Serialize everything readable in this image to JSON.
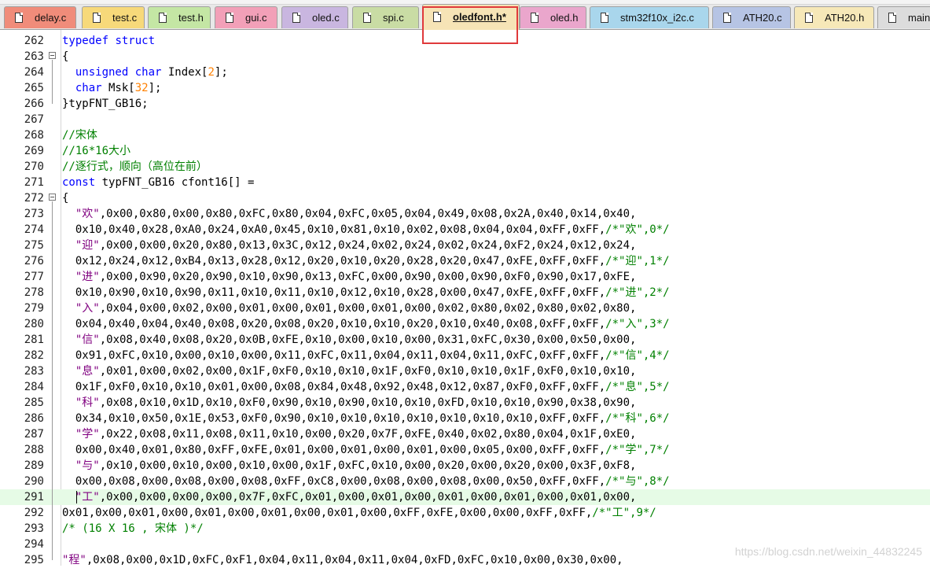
{
  "tabs": [
    {
      "label": "delay.c",
      "color": "#f08c7a",
      "active": false
    },
    {
      "label": "test.c",
      "color": "#f7d97a",
      "active": false
    },
    {
      "label": "test.h",
      "color": "#c4e6a4",
      "active": false
    },
    {
      "label": "gui.c",
      "color": "#f2a0b8",
      "active": false
    },
    {
      "label": "oled.c",
      "color": "#c9b6e0",
      "active": false
    },
    {
      "label": "spi.c",
      "color": "#c9dca4",
      "active": false
    },
    {
      "label": "oledfont.h*",
      "color": "#f6e4b6",
      "active": true
    },
    {
      "label": "oled.h",
      "color": "#eaa6cc",
      "active": false
    },
    {
      "label": "stm32f10x_i2c.c",
      "color": "#a9d6ec",
      "active": false
    },
    {
      "label": "ATH20.c",
      "color": "#b6c4e4",
      "active": false
    },
    {
      "label": "ATH20.h",
      "color": "#f6e8b8",
      "active": false
    },
    {
      "label": "main",
      "color": "#dcdcdc",
      "active": false
    }
  ],
  "editor": {
    "current_line": 291,
    "lines": [
      {
        "num": 262,
        "code": "typedef struct"
      },
      {
        "num": 263,
        "code": "{"
      },
      {
        "num": 264,
        "code": "  unsigned char Index[2];"
      },
      {
        "num": 265,
        "code": "  char Msk[32];"
      },
      {
        "num": 266,
        "code": "}typFNT_GB16;"
      },
      {
        "num": 267,
        "code": ""
      },
      {
        "num": 268,
        "code": "//宋体"
      },
      {
        "num": 269,
        "code": "//16*16大小"
      },
      {
        "num": 270,
        "code": "//逐行式，顺向（高位在前）"
      },
      {
        "num": 271,
        "code": "const typFNT_GB16 cfont16[] ="
      },
      {
        "num": 272,
        "code": "{"
      },
      {
        "num": 273,
        "code": "  \"欢\",0x00,0x80,0x00,0x80,0xFC,0x80,0x04,0xFC,0x05,0x04,0x49,0x08,0x2A,0x40,0x14,0x40,"
      },
      {
        "num": 274,
        "code": "  0x10,0x40,0x28,0xA0,0x24,0xA0,0x45,0x10,0x81,0x10,0x02,0x08,0x04,0x04,0xFF,0xFF,/*\"欢\",0*/"
      },
      {
        "num": 275,
        "code": "  \"迎\",0x00,0x00,0x20,0x80,0x13,0x3C,0x12,0x24,0x02,0x24,0x02,0x24,0xF2,0x24,0x12,0x24,"
      },
      {
        "num": 276,
        "code": "  0x12,0x24,0x12,0xB4,0x13,0x28,0x12,0x20,0x10,0x20,0x28,0x20,0x47,0xFE,0xFF,0xFF,/*\"迎\",1*/"
      },
      {
        "num": 277,
        "code": "  \"进\",0x00,0x90,0x20,0x90,0x10,0x90,0x13,0xFC,0x00,0x90,0x00,0x90,0xF0,0x90,0x17,0xFE,"
      },
      {
        "num": 278,
        "code": "  0x10,0x90,0x10,0x90,0x11,0x10,0x11,0x10,0x12,0x10,0x28,0x00,0x47,0xFE,0xFF,0xFF,/*\"进\",2*/"
      },
      {
        "num": 279,
        "code": "  \"入\",0x04,0x00,0x02,0x00,0x01,0x00,0x01,0x00,0x01,0x00,0x02,0x80,0x02,0x80,0x02,0x80,"
      },
      {
        "num": 280,
        "code": "  0x04,0x40,0x04,0x40,0x08,0x20,0x08,0x20,0x10,0x10,0x20,0x10,0x40,0x08,0xFF,0xFF,/*\"入\",3*/"
      },
      {
        "num": 281,
        "code": "  \"信\",0x08,0x40,0x08,0x20,0x0B,0xFE,0x10,0x00,0x10,0x00,0x31,0xFC,0x30,0x00,0x50,0x00,"
      },
      {
        "num": 282,
        "code": "  0x91,0xFC,0x10,0x00,0x10,0x00,0x11,0xFC,0x11,0x04,0x11,0x04,0x11,0xFC,0xFF,0xFF,/*\"信\",4*/"
      },
      {
        "num": 283,
        "code": "  \"息\",0x01,0x00,0x02,0x00,0x1F,0xF0,0x10,0x10,0x1F,0xF0,0x10,0x10,0x1F,0xF0,0x10,0x10,"
      },
      {
        "num": 284,
        "code": "  0x1F,0xF0,0x10,0x10,0x01,0x00,0x08,0x84,0x48,0x92,0x48,0x12,0x87,0xF0,0xFF,0xFF,/*\"息\",5*/"
      },
      {
        "num": 285,
        "code": "  \"科\",0x08,0x10,0x1D,0x10,0xF0,0x90,0x10,0x90,0x10,0x10,0xFD,0x10,0x10,0x90,0x38,0x90,"
      },
      {
        "num": 286,
        "code": "  0x34,0x10,0x50,0x1E,0x53,0xF0,0x90,0x10,0x10,0x10,0x10,0x10,0x10,0x10,0xFF,0xFF,/*\"科\",6*/"
      },
      {
        "num": 287,
        "code": "  \"学\",0x22,0x08,0x11,0x08,0x11,0x10,0x00,0x20,0x7F,0xFE,0x40,0x02,0x80,0x04,0x1F,0xE0,"
      },
      {
        "num": 288,
        "code": "  0x00,0x40,0x01,0x80,0xFF,0xFE,0x01,0x00,0x01,0x00,0x01,0x00,0x05,0x00,0xFF,0xFF,/*\"学\",7*/"
      },
      {
        "num": 289,
        "code": "  \"与\",0x10,0x00,0x10,0x00,0x10,0x00,0x1F,0xFC,0x10,0x00,0x20,0x00,0x20,0x00,0x3F,0xF8,"
      },
      {
        "num": 290,
        "code": "  0x00,0x08,0x00,0x08,0x00,0x08,0xFF,0xC8,0x00,0x08,0x00,0x08,0x00,0x50,0xFF,0xFF,/*\"与\",8*/"
      },
      {
        "num": 291,
        "code": "  \"工\",0x00,0x00,0x00,0x00,0x7F,0xFC,0x01,0x00,0x01,0x00,0x01,0x00,0x01,0x00,0x01,0x00,"
      },
      {
        "num": 292,
        "code": "0x01,0x00,0x01,0x00,0x01,0x00,0x01,0x00,0x01,0x00,0xFF,0xFE,0x00,0x00,0xFF,0xFF,/*\"工\",9*/"
      },
      {
        "num": 293,
        "code": "/* (16 X 16 , 宋体 )*/"
      },
      {
        "num": 294,
        "code": ""
      },
      {
        "num": 295,
        "code": "\"程\",0x08,0x00,0x1D,0xFC,0xF1,0x04,0x11,0x04,0x11,0x04,0xFD,0xFC,0x10,0x00,0x30,0x00,"
      }
    ]
  },
  "watermark": "https://blog.csdn.net/weixin_44832245"
}
